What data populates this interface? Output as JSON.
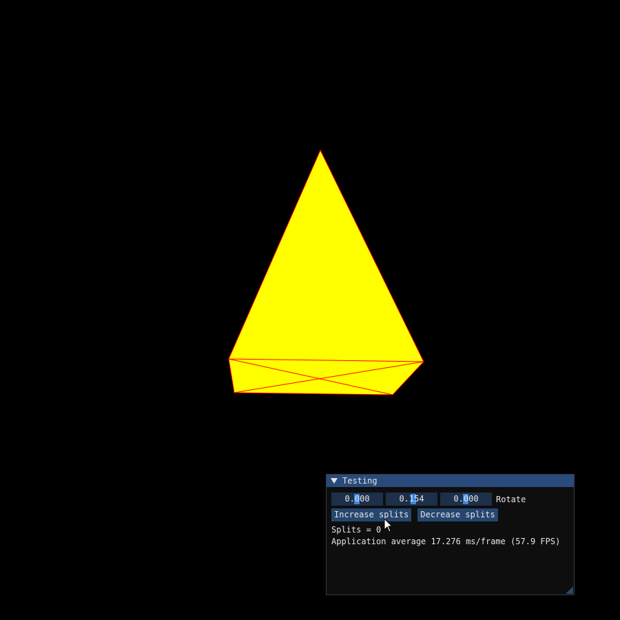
{
  "scene": {
    "fill_color": "#ffff00",
    "edge_color": "#ff0000",
    "background": "#000000"
  },
  "window": {
    "title": "Testing",
    "collapse_icon": "triangle-down-icon",
    "sliders": [
      "0.000",
      "0.154",
      "0.000"
    ],
    "slider_label": "Rotate",
    "increase_label": "Increase splits",
    "decrease_label": "Decrease splits",
    "splits_text": "Splits = 0",
    "perf_text": "Application average 17.276 ms/frame (57.9 FPS)"
  }
}
